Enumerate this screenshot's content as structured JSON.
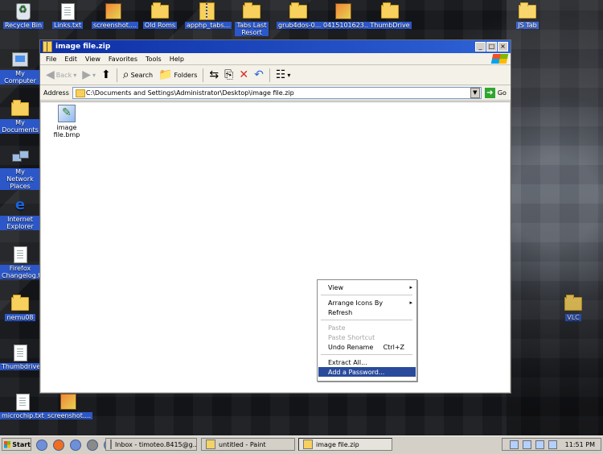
{
  "desktop": {
    "icons": [
      {
        "label": "Recycle Bin",
        "icon": "recycle-bin-icon"
      },
      {
        "label": "Links.txt",
        "icon": "text-file-icon"
      },
      {
        "label": "screenshot....",
        "icon": "image-file-icon"
      },
      {
        "label": "Old Roms",
        "icon": "folder-icon"
      },
      {
        "label": "apphp_tabs...",
        "icon": "zip-file-icon"
      },
      {
        "label": "Tabs Last Resort",
        "icon": "folder-icon"
      },
      {
        "label": "grub4dos-0...",
        "icon": "folder-icon"
      },
      {
        "label": "0415101623...",
        "icon": "image-file-icon"
      },
      {
        "label": "ThumbDrive",
        "icon": "folder-icon"
      },
      {
        "label": "JS Tab",
        "icon": "folder-icon"
      },
      {
        "label": "My Computer",
        "icon": "my-computer-icon"
      },
      {
        "label": "My Documents",
        "icon": "my-documents-icon"
      },
      {
        "label": "My Network Places",
        "icon": "network-places-icon"
      },
      {
        "label": "Internet Explorer",
        "icon": "internet-explorer-icon"
      },
      {
        "label": "Firefox Changelog.txt",
        "icon": "text-file-icon"
      },
      {
        "label": "nemu08",
        "icon": "folder-icon"
      },
      {
        "label": "Thumbdrive.txt",
        "icon": "text-file-icon"
      },
      {
        "label": "microchip.txt",
        "icon": "text-file-icon"
      },
      {
        "label": "screenshot....",
        "icon": "image-file-icon"
      },
      {
        "label": "VLC",
        "icon": "folder-icon"
      }
    ]
  },
  "window": {
    "title": "image file.zip",
    "menu": [
      "File",
      "Edit",
      "View",
      "Favorites",
      "Tools",
      "Help"
    ],
    "toolbar": {
      "back": "Back",
      "search": "Search",
      "folders": "Folders"
    },
    "address": {
      "label": "Address",
      "value": "C:\\Documents and Settings\\Administrator\\Desktop\\image file.zip",
      "go": "Go"
    },
    "files": [
      {
        "name": "image file.bmp",
        "icon": "bitmap-file-icon"
      }
    ]
  },
  "context_menu": {
    "items": [
      {
        "label": "View",
        "arrow": "▸"
      },
      {
        "label": "Arrange Icons By",
        "arrow": "▸"
      },
      {
        "label": "Refresh"
      },
      {
        "label": "Paste"
      },
      {
        "label": "Paste Shortcut"
      },
      {
        "label": "Undo Rename",
        "shortcut": "Ctrl+Z"
      },
      {
        "label": "Extract All..."
      },
      {
        "label": "Add a Password..."
      }
    ]
  },
  "taskbar": {
    "start": "Start",
    "tasks": [
      {
        "label": "Inbox - timoteo.8415@g..."
      },
      {
        "label": "untitled - Paint"
      },
      {
        "label": "image file.zip"
      }
    ],
    "clock": "11:51 PM"
  }
}
